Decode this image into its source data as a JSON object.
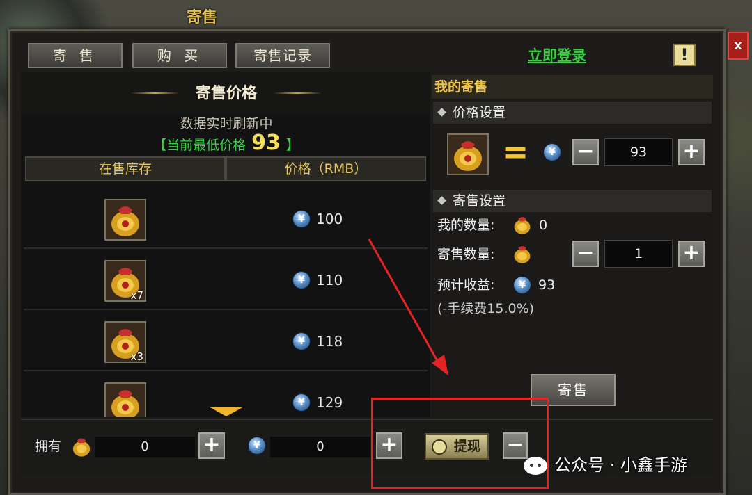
{
  "window": {
    "title": "寄售"
  },
  "tabs": [
    {
      "label": "寄 售"
    },
    {
      "label": "购 买"
    },
    {
      "label": "寄售记录"
    }
  ],
  "header": {
    "login_label": "立即登录",
    "help_label": "!",
    "close_label": "x"
  },
  "price_panel": {
    "title": "寄售价格",
    "refresh_text": "数据实时刷新中",
    "lowest_prefix": "【当前最低价格",
    "lowest_value": "93",
    "lowest_suffix": "】",
    "columns": [
      "在售库存",
      "价格（RMB）"
    ],
    "rows": [
      {
        "qty": "",
        "price": "100"
      },
      {
        "qty": "x7",
        "price": "110"
      },
      {
        "qty": "x3",
        "price": "118"
      },
      {
        "qty": "",
        "price": "129"
      }
    ]
  },
  "my_sale": {
    "title": "我的寄售",
    "price_setting": {
      "label": "价格设置",
      "equals": "=",
      "value": "93"
    },
    "sale_setting": {
      "label": "寄售设置",
      "my_qty_label": "我的数量:",
      "my_qty_value": "0",
      "sell_qty_label": "寄售数量:",
      "sell_qty_value": "1",
      "income_label": "预计收益:",
      "income_value": "93",
      "fee_text": "(-手续费15.0%)"
    },
    "sell_button": "寄售"
  },
  "bottom": {
    "own_label": "拥有",
    "item_amount": "0",
    "coin_amount": "0",
    "withdraw_label": "提现"
  },
  "icons": {
    "coin": "¥",
    "plus": "+",
    "minus": "−"
  },
  "watermark": "公众号 · 小鑫手游",
  "colors": {
    "accent_gold": "#e6c760",
    "login_green": "#3bcf45",
    "annotation_red": "#e62323"
  }
}
